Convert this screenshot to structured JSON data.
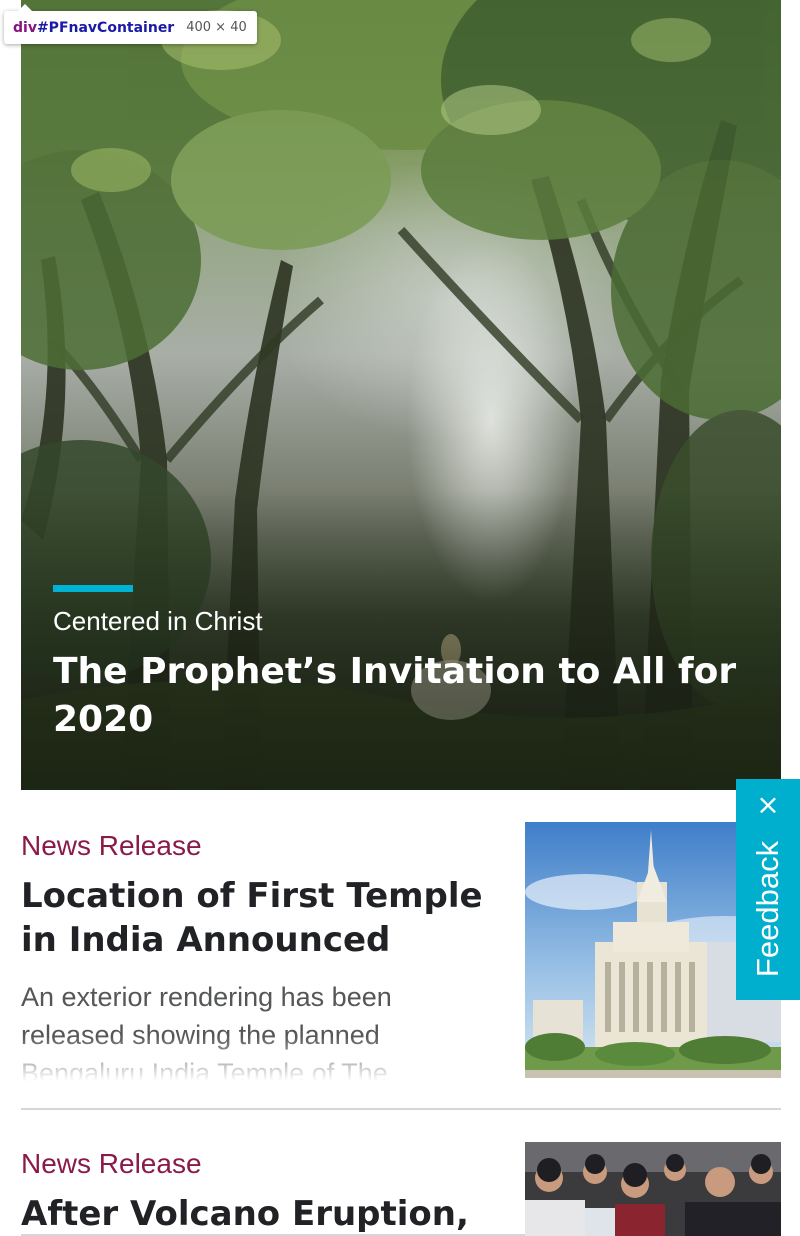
{
  "devtools_tooltip": {
    "tag": "div",
    "id": "#PFnavContainer",
    "size": "400 × 40"
  },
  "hero": {
    "kicker": "Centered in Christ",
    "title": "The Prophet’s Invitation to All for 2020",
    "accent_color": "#00b2d4"
  },
  "articles": [
    {
      "kicker": "News Release",
      "headline": "Location of First Temple in India Announced",
      "summary": "An exterior rendering has been released showing the planned Bengaluru India Temple of The",
      "image": "temple-rendering-image"
    },
    {
      "kicker": "News Release",
      "headline": "After Volcano Eruption,",
      "image": "crowd-photo-image"
    }
  ],
  "feedback": {
    "label": "Feedback",
    "close_icon": "close-icon",
    "color": "#00aecd"
  },
  "colors": {
    "kicker": "#8a1a4a",
    "headline": "#212225",
    "summary": "#555657",
    "divider": "#d6d6d6"
  }
}
